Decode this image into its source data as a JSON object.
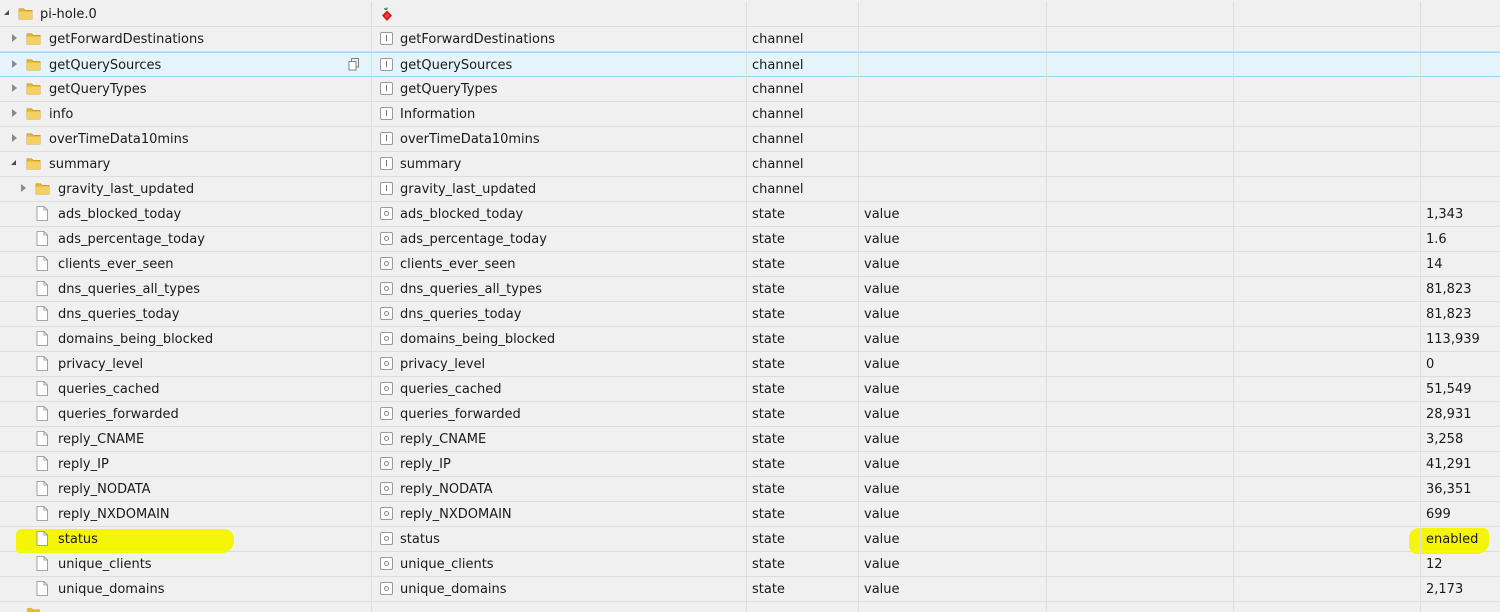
{
  "root": {
    "label": "pi-hole.0",
    "role_icon": "pi-hole-logo"
  },
  "rows": [
    {
      "name": "getForwardDestinations",
      "display": "getForwardDestinations",
      "type": "channel",
      "role": "",
      "value": "",
      "kind": "folder",
      "level": 1,
      "state": "collapsed"
    },
    {
      "name": "getQuerySources",
      "display": "getQuerySources",
      "type": "channel",
      "role": "",
      "value": "",
      "kind": "folder",
      "level": 1,
      "state": "collapsed"
    },
    {
      "name": "getQueryTypes",
      "display": "getQueryTypes",
      "type": "channel",
      "role": "",
      "value": "",
      "kind": "folder",
      "level": 1,
      "state": "collapsed"
    },
    {
      "name": "info",
      "display": "Information",
      "type": "channel",
      "role": "",
      "value": "",
      "kind": "folder",
      "level": 1,
      "state": "collapsed"
    },
    {
      "name": "overTimeData10mins",
      "display": "overTimeData10mins",
      "type": "channel",
      "role": "",
      "value": "",
      "kind": "folder",
      "level": 1,
      "state": "collapsed"
    },
    {
      "name": "summary",
      "display": "summary",
      "type": "channel",
      "role": "",
      "value": "",
      "kind": "folder",
      "level": 1,
      "state": "expanded"
    },
    {
      "name": "gravity_last_updated",
      "display": "gravity_last_updated",
      "type": "channel",
      "role": "",
      "value": "",
      "kind": "folder",
      "level": 2,
      "state": "collapsed"
    },
    {
      "name": "ads_blocked_today",
      "display": "ads_blocked_today",
      "type": "state",
      "role": "value",
      "value": "1,343",
      "kind": "file",
      "level": 2
    },
    {
      "name": "ads_percentage_today",
      "display": "ads_percentage_today",
      "type": "state",
      "role": "value",
      "value": "1.6",
      "kind": "file",
      "level": 2
    },
    {
      "name": "clients_ever_seen",
      "display": "clients_ever_seen",
      "type": "state",
      "role": "value",
      "value": "14",
      "kind": "file",
      "level": 2
    },
    {
      "name": "dns_queries_all_types",
      "display": "dns_queries_all_types",
      "type": "state",
      "role": "value",
      "value": "81,823",
      "kind": "file",
      "level": 2
    },
    {
      "name": "dns_queries_today",
      "display": "dns_queries_today",
      "type": "state",
      "role": "value",
      "value": "81,823",
      "kind": "file",
      "level": 2
    },
    {
      "name": "domains_being_blocked",
      "display": "domains_being_blocked",
      "type": "state",
      "role": "value",
      "value": "113,939",
      "kind": "file",
      "level": 2
    },
    {
      "name": "privacy_level",
      "display": "privacy_level",
      "type": "state",
      "role": "value",
      "value": "0",
      "kind": "file",
      "level": 2
    },
    {
      "name": "queries_cached",
      "display": "queries_cached",
      "type": "state",
      "role": "value",
      "value": "51,549",
      "kind": "file",
      "level": 2
    },
    {
      "name": "queries_forwarded",
      "display": "queries_forwarded",
      "type": "state",
      "role": "value",
      "value": "28,931",
      "kind": "file",
      "level": 2
    },
    {
      "name": "reply_CNAME",
      "display": "reply_CNAME",
      "type": "state",
      "role": "value",
      "value": "3,258",
      "kind": "file",
      "level": 2
    },
    {
      "name": "reply_IP",
      "display": "reply_IP",
      "type": "state",
      "role": "value",
      "value": "41,291",
      "kind": "file",
      "level": 2
    },
    {
      "name": "reply_NODATA",
      "display": "reply_NODATA",
      "type": "state",
      "role": "value",
      "value": "36,351",
      "kind": "file",
      "level": 2
    },
    {
      "name": "reply_NXDOMAIN",
      "display": "reply_NXDOMAIN",
      "type": "state",
      "role": "value",
      "value": "699",
      "kind": "file",
      "level": 2
    },
    {
      "name": "status",
      "display": "status",
      "type": "state",
      "role": "value",
      "value": "enabled",
      "kind": "file",
      "level": 2
    },
    {
      "name": "unique_clients",
      "display": "unique_clients",
      "type": "state",
      "role": "value",
      "value": "12",
      "kind": "file",
      "level": 2
    },
    {
      "name": "unique_domains",
      "display": "unique_domains",
      "type": "state",
      "role": "value",
      "value": "2,173",
      "kind": "file",
      "level": 2
    }
  ],
  "selected_row": "getQuerySources",
  "highlighted_row": "status",
  "colors": {
    "selection": "#e5f3fb",
    "highlight": "#f5f50a",
    "folder": "#e8b830"
  },
  "icons": {
    "folder": "folder-icon",
    "file": "file-icon",
    "copy": "copy-icon",
    "expander_collapsed": "chevron-right-icon",
    "expander_expanded": "chevron-down-icon"
  }
}
